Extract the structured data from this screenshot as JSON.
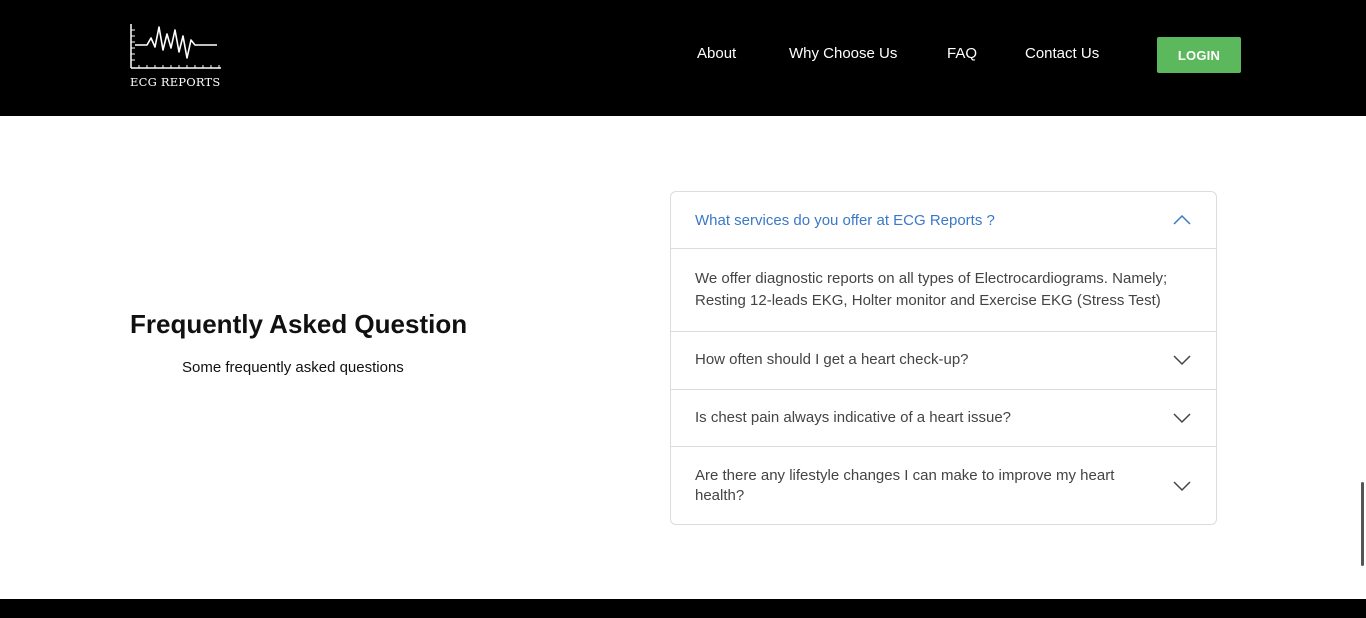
{
  "brand": {
    "name": "ECG REPORTS",
    "logo_icon": "ecg-waveform-icon"
  },
  "nav": {
    "links": [
      "About",
      "Why Choose Us",
      "FAQ",
      "Contact Us"
    ],
    "login_label": "LOGIN"
  },
  "colors": {
    "navbar_bg": "#000000",
    "login_bg": "#5cb85c",
    "active_question": "#3a78c9",
    "border": "#dcdcdc"
  },
  "faq": {
    "title": "Frequently Asked Question",
    "subtitle": "Some frequently asked questions",
    "items": [
      {
        "question": "What services do you offer at ECG Reports ?",
        "answer": "We offer diagnostic reports on all types of Electrocardiograms. Namely; Resting 12-leads EKG, Holter monitor and Exercise EKG (Stress Test)",
        "expanded": true,
        "icon": "chevron-up-icon"
      },
      {
        "question": "How often should I get a heart check-up?",
        "expanded": false,
        "icon": "chevron-down-icon"
      },
      {
        "question": "Is chest pain always indicative of a heart issue?",
        "expanded": false,
        "icon": "chevron-down-icon"
      },
      {
        "question": "Are there any lifestyle changes I can make to improve my heart health?",
        "expanded": false,
        "icon": "chevron-down-icon"
      }
    ]
  }
}
